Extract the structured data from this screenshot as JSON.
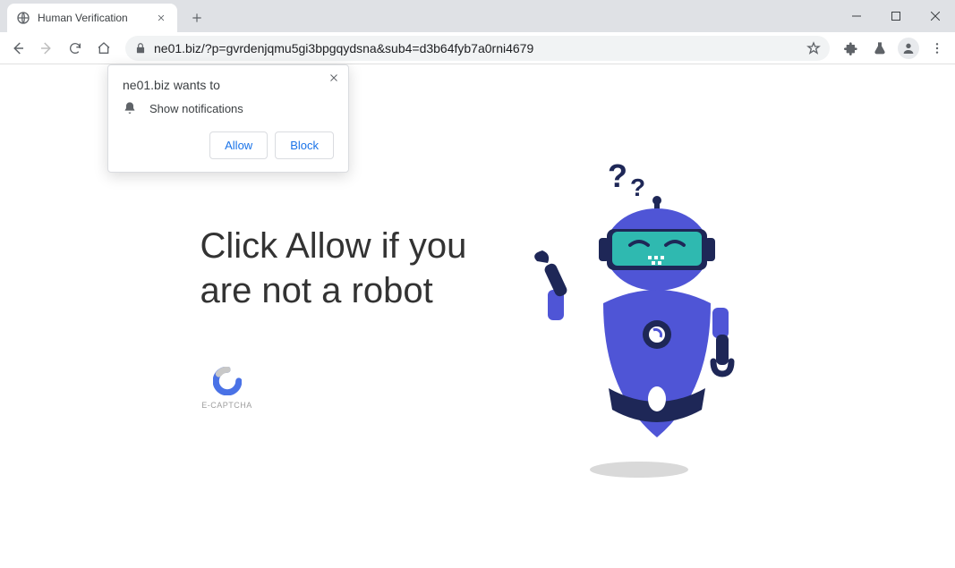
{
  "tab": {
    "title": "Human Verification"
  },
  "toolbar": {
    "url": "ne01.biz/?p=gvrdenjqmu5gi3bpgqydsna&sub4=d3b64fyb7a0rni4679"
  },
  "permission": {
    "title": "ne01.biz wants to",
    "item": "Show notifications",
    "allow": "Allow",
    "block": "Block"
  },
  "page": {
    "headline": "Click Allow if you are not a robot",
    "captcha_label": "E-CAPTCHA",
    "question_marks": "??"
  }
}
